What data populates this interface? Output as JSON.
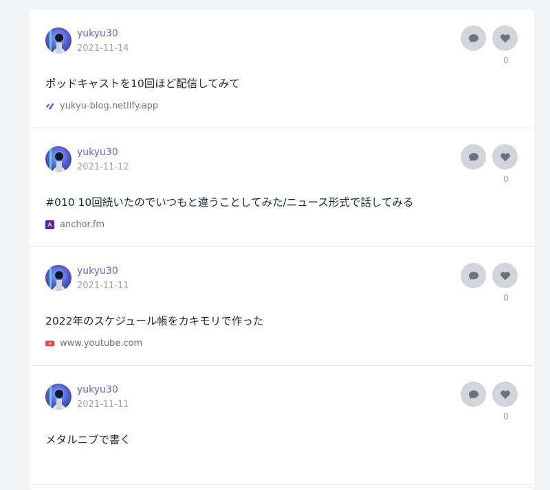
{
  "posts": [
    {
      "author": "yukyu30",
      "date": "2021-11-14",
      "title": "ポッドキャストを10回ほど配信してみて",
      "source": "yukyu-blog.netlify.app",
      "source_icon": "netlify-icon",
      "likes": "0"
    },
    {
      "author": "yukyu30",
      "date": "2021-11-12",
      "title": "#010 10回続いたのでいつもと違うことしてみた/ニュース形式で話してみる",
      "source": "anchor.fm",
      "source_icon": "anchor-icon",
      "likes": "0"
    },
    {
      "author": "yukyu30",
      "date": "2021-11-11",
      "title": "2022年のスケジュール帳をカキモリで作った",
      "source": "www.youtube.com",
      "source_icon": "youtube-icon",
      "likes": "0"
    },
    {
      "author": "yukyu30",
      "date": "2021-11-11",
      "title": "メタルニブで書く",
      "source": "",
      "source_icon": "",
      "likes": "0"
    }
  ],
  "colors": {
    "author": "#6366d1",
    "action_bg": "#d1d5db",
    "action_icon": "#6b7280"
  }
}
